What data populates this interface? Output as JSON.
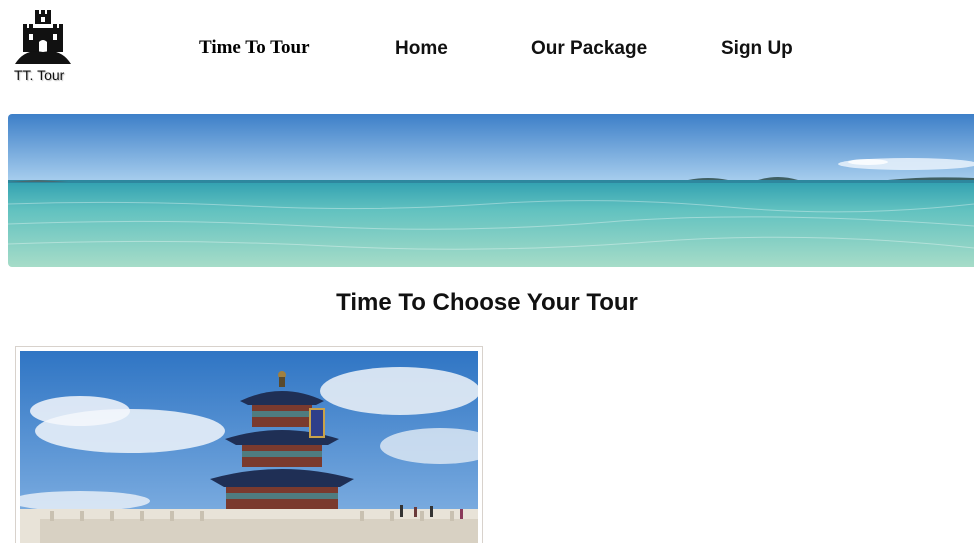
{
  "header": {
    "logo_text": "TT. Tour",
    "brand": "Time To Tour",
    "nav": {
      "home": "Home",
      "package": "Our Package",
      "signup": "Sign Up"
    }
  },
  "banner": {
    "image": "ocean-panorama"
  },
  "main": {
    "title": "Time To Choose Your Tour",
    "tours": [
      {
        "image": "temple-of-heaven-photo"
      }
    ]
  },
  "colors": {
    "sky": "#4f8fd0",
    "sea": "#79c6bb",
    "text": "#111111"
  }
}
